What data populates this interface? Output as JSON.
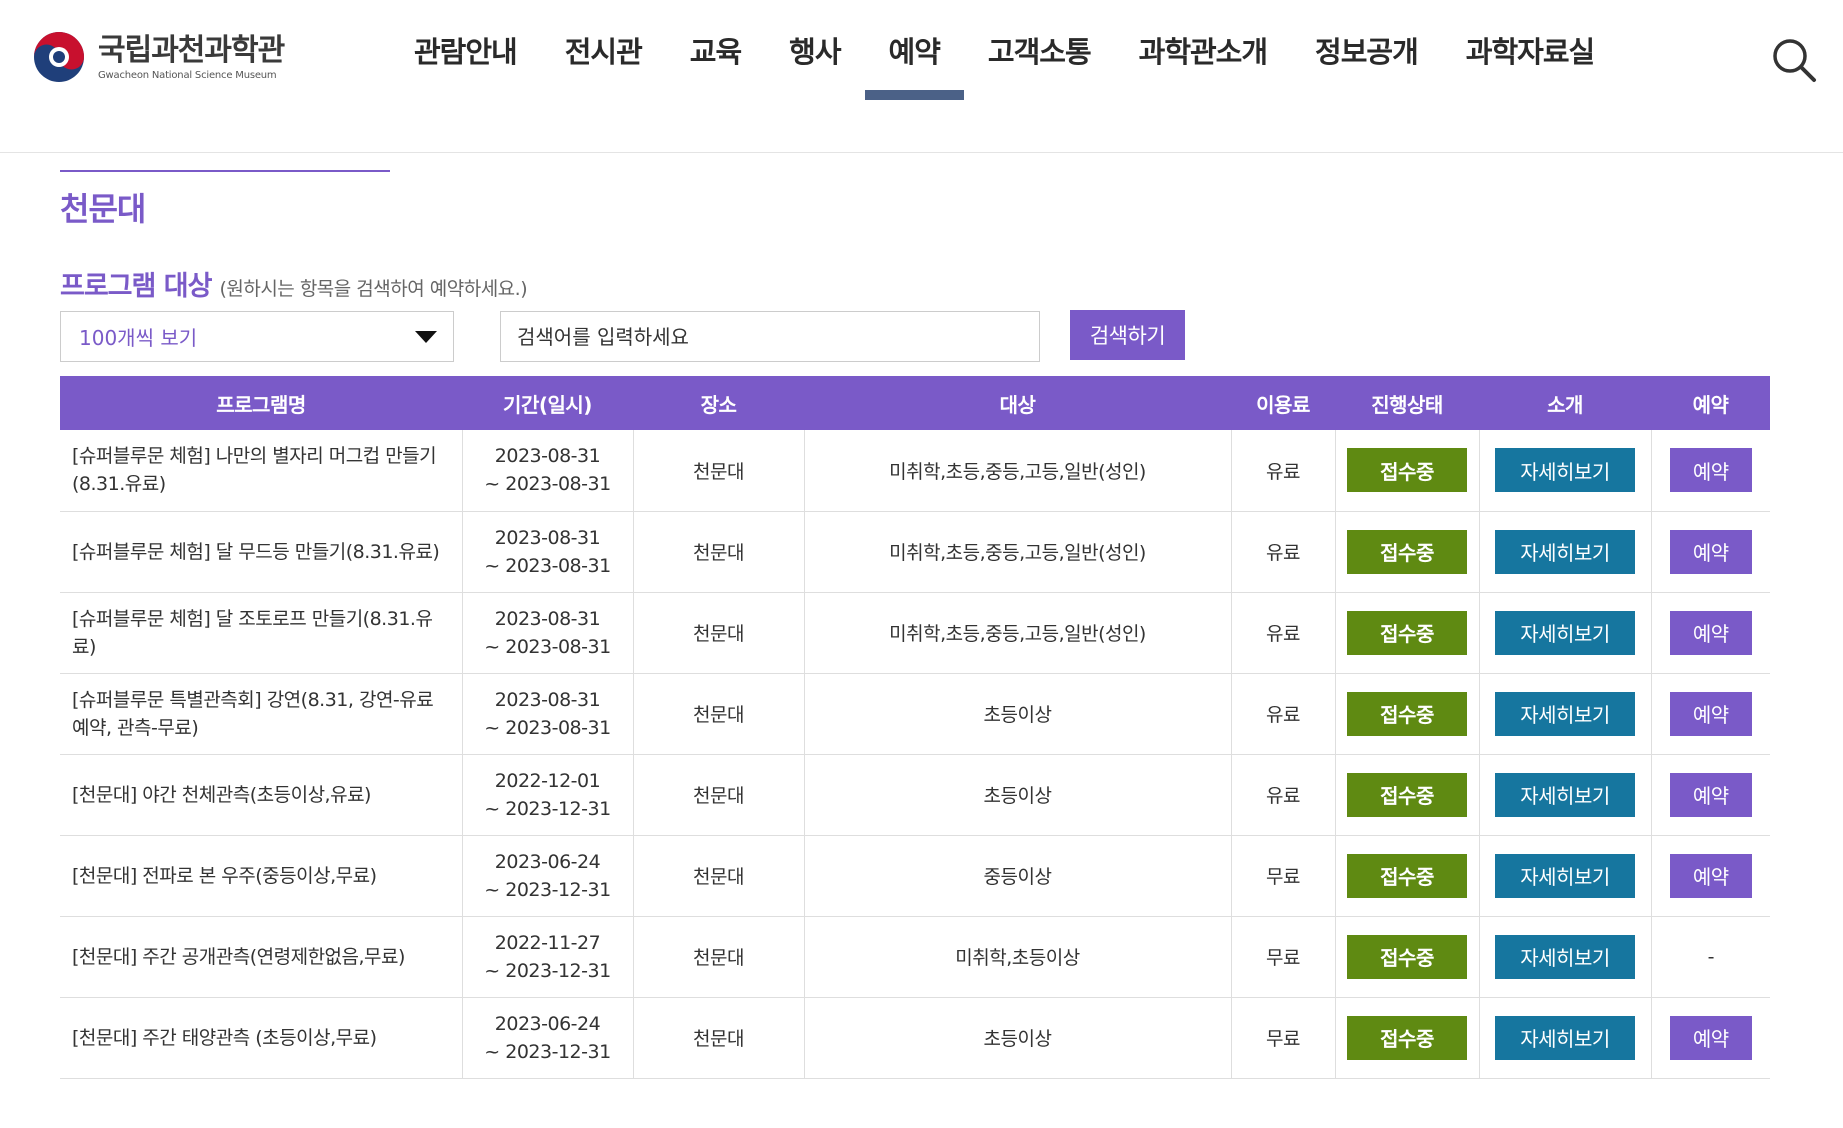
{
  "header": {
    "logo_ko": "국립과천과학관",
    "logo_en": "Gwacheon National Science Museum",
    "nav": [
      "관람안내",
      "전시관",
      "교육",
      "행사",
      "예약",
      "고객소통",
      "과학관소개",
      "정보공개",
      "과학자료실"
    ],
    "active_nav": "예약"
  },
  "page": {
    "title": "천문대"
  },
  "filter": {
    "label": "프로그램 대상",
    "hint": "(원하시는 항목을 검색하여 예약하세요.)",
    "select_value": "100개씩 보기",
    "search_placeholder": "검색어를 입력하세요",
    "search_button": "검색하기"
  },
  "table": {
    "columns": [
      "프로그램명",
      "기간(일시)",
      "장소",
      "대상",
      "이용료",
      "진행상태",
      "소개",
      "예약"
    ],
    "rows": [
      {
        "name": "[슈퍼블루문 체험] 나만의 별자리 머그컵 만들기(8.31.유료)",
        "start": "2023-08-31",
        "end": "~ 2023-08-31",
        "place": "천문대",
        "target": "미취학,초등,중등,고등,일반(성인)",
        "fee": "유료",
        "status": "접수중",
        "detail": "자세히보기",
        "reserve": "예약"
      },
      {
        "name": "[슈퍼블루문 체험] 달 무드등 만들기(8.31.유료)",
        "start": "2023-08-31",
        "end": "~ 2023-08-31",
        "place": "천문대",
        "target": "미취학,초등,중등,고등,일반(성인)",
        "fee": "유료",
        "status": "접수중",
        "detail": "자세히보기",
        "reserve": "예약"
      },
      {
        "name": "[슈퍼블루문 체험] 달 조토로프 만들기(8.31.유료)",
        "start": "2023-08-31",
        "end": "~ 2023-08-31",
        "place": "천문대",
        "target": "미취학,초등,중등,고등,일반(성인)",
        "fee": "유료",
        "status": "접수중",
        "detail": "자세히보기",
        "reserve": "예약"
      },
      {
        "name": "[슈퍼블루문 특별관측회] 강연(8.31, 강연-유료예약, 관측-무료)",
        "start": "2023-08-31",
        "end": "~ 2023-08-31",
        "place": "천문대",
        "target": "초등이상",
        "fee": "유료",
        "status": "접수중",
        "detail": "자세히보기",
        "reserve": "예약"
      },
      {
        "name": "[천문대] 야간 천체관측(초등이상,유료)",
        "start": "2022-12-01",
        "end": "~ 2023-12-31",
        "place": "천문대",
        "target": "초등이상",
        "fee": "유료",
        "status": "접수중",
        "detail": "자세히보기",
        "reserve": "예약"
      },
      {
        "name": "[천문대] 전파로 본 우주(중등이상,무료)",
        "start": "2023-06-24",
        "end": "~ 2023-12-31",
        "place": "천문대",
        "target": "중등이상",
        "fee": "무료",
        "status": "접수중",
        "detail": "자세히보기",
        "reserve": "예약"
      },
      {
        "name": "[천문대] 주간 공개관측(연령제한없음,무료)",
        "start": "2022-11-27",
        "end": "~ 2023-12-31",
        "place": "천문대",
        "target": "미취학,초등이상",
        "fee": "무료",
        "status": "접수중",
        "detail": "자세히보기",
        "reserve": "-"
      },
      {
        "name": "[천문대] 주간 태양관측 (초등이상,무료)",
        "start": "2023-06-24",
        "end": "~ 2023-12-31",
        "place": "천문대",
        "target": "초등이상",
        "fee": "무료",
        "status": "접수중",
        "detail": "자세히보기",
        "reserve": "예약"
      }
    ]
  },
  "colors": {
    "accent": "#7a5ac8",
    "status_green": "#5f8a12",
    "detail_blue": "#16769f",
    "nav_underline": "#4b6187"
  },
  "icons": {
    "logo": "taegeuk-logo-icon",
    "search": "search-icon",
    "dropdown": "triangle-down-icon"
  }
}
